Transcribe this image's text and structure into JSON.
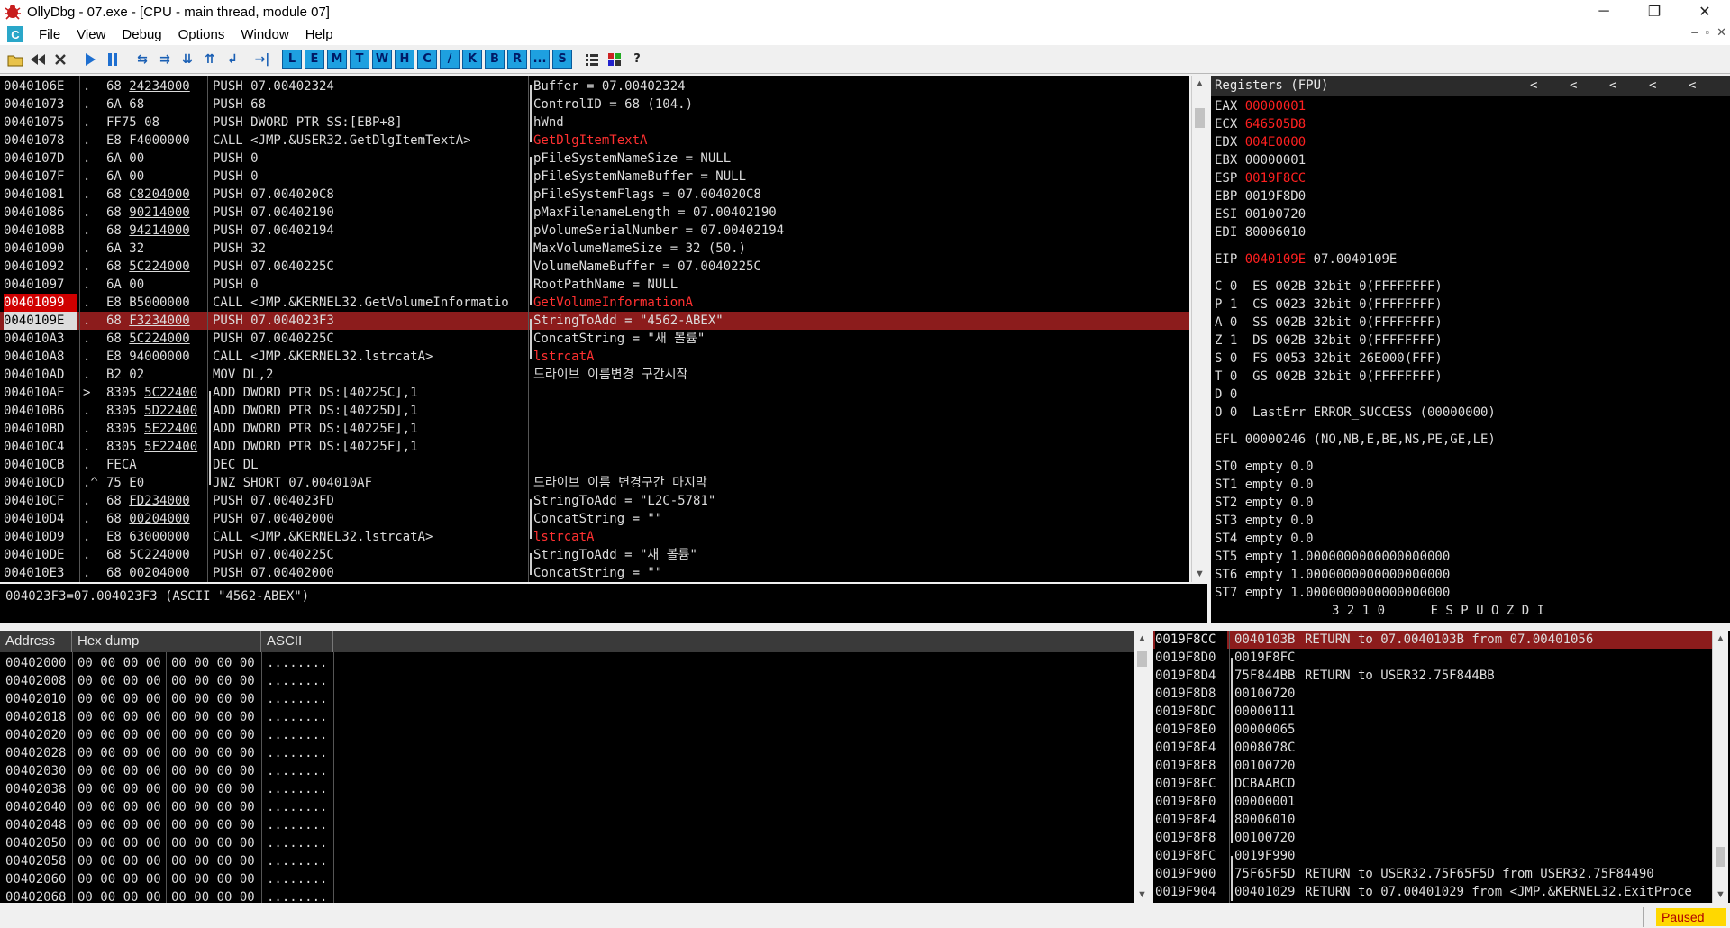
{
  "window": {
    "title": "OllyDbg - 07.exe - [CPU - main thread, module 07]",
    "minimize": "─",
    "maximize": "❐",
    "close": "✕"
  },
  "menu": {
    "cpu_badge": "C",
    "items": [
      "File",
      "View",
      "Debug",
      "Options",
      "Window",
      "Help"
    ],
    "mdi": [
      "–",
      "▫",
      "✕"
    ]
  },
  "toolbar": {
    "letters": [
      "L",
      "E",
      "M",
      "T",
      "W",
      "H",
      "C",
      "/",
      "K",
      "B",
      "R",
      "...",
      "S"
    ]
  },
  "disasm": {
    "rows": [
      {
        "addr": "0040106E",
        "mk": ".",
        "hex": "68 ",
        "hexu": "24234000",
        "ins": "PUSH 07.00402324",
        "cmt": "Buffer = 07.00402324",
        "red": false
      },
      {
        "addr": "00401073",
        "mk": ".",
        "hex": "6A 68",
        "hexu": "",
        "ins": "PUSH 68",
        "cmt": "ControlID = 68 (104.)",
        "red": false
      },
      {
        "addr": "00401075",
        "mk": ".",
        "hex": "FF75 08",
        "hexu": "",
        "ins": "PUSH DWORD PTR SS:[EBP+8]",
        "cmt": "hWnd",
        "red": false
      },
      {
        "addr": "00401078",
        "mk": ".",
        "hex": "E8 F4000000",
        "hexu": "",
        "ins": "CALL <JMP.&USER32.GetDlgItemTextA>",
        "cmt": "GetDlgItemTextA",
        "red": true
      },
      {
        "addr": "0040107D",
        "mk": ".",
        "hex": "6A 00",
        "hexu": "",
        "ins": "PUSH 0",
        "cmt": "pFileSystemNameSize = NULL",
        "red": false
      },
      {
        "addr": "0040107F",
        "mk": ".",
        "hex": "6A 00",
        "hexu": "",
        "ins": "PUSH 0",
        "cmt": "pFileSystemNameBuffer = NULL",
        "red": false
      },
      {
        "addr": "00401081",
        "mk": ".",
        "hex": "68 ",
        "hexu": "C8204000",
        "ins": "PUSH 07.004020C8",
        "cmt": "pFileSystemFlags = 07.004020C8",
        "red": false
      },
      {
        "addr": "00401086",
        "mk": ".",
        "hex": "68 ",
        "hexu": "90214000",
        "ins": "PUSH 07.00402190",
        "cmt": "pMaxFilenameLength = 07.00402190",
        "red": false
      },
      {
        "addr": "0040108B",
        "mk": ".",
        "hex": "68 ",
        "hexu": "94214000",
        "ins": "PUSH 07.00402194",
        "cmt": "pVolumeSerialNumber = 07.00402194",
        "red": false
      },
      {
        "addr": "00401090",
        "mk": ".",
        "hex": "6A 32",
        "hexu": "",
        "ins": "PUSH 32",
        "cmt": "MaxVolumeNameSize = 32 (50.)",
        "red": false
      },
      {
        "addr": "00401092",
        "mk": ".",
        "hex": "68 ",
        "hexu": "5C224000",
        "ins": "PUSH 07.0040225C",
        "cmt": "VolumeNameBuffer = 07.0040225C",
        "red": false
      },
      {
        "addr": "00401097",
        "mk": ".",
        "hex": "6A 00",
        "hexu": "",
        "ins": "PUSH 0",
        "cmt": "RootPathName = NULL",
        "red": false
      },
      {
        "addr": "00401099",
        "mk": ".",
        "hex": "E8 B5000000",
        "hexu": "",
        "ins": "CALL <JMP.&KERNEL32.GetVolumeInformatio",
        "cmt": "GetVolumeInformationA",
        "red": true
      },
      {
        "addr": "0040109E",
        "mk": ".",
        "hex": "68 ",
        "hexu": "F3234000",
        "ins": "PUSH 07.004023F3",
        "cmt": "StringToAdd = \"4562-ABEX\"",
        "red": false
      },
      {
        "addr": "004010A3",
        "mk": ".",
        "hex": "68 ",
        "hexu": "5C224000",
        "ins": "PUSH 07.0040225C",
        "cmt": "ConcatString = \"새 볼륨\"",
        "red": false
      },
      {
        "addr": "004010A8",
        "mk": ".",
        "hex": "E8 94000000",
        "hexu": "",
        "ins": "CALL <JMP.&KERNEL32.lstrcatA>",
        "cmt": "lstrcatA",
        "red": true
      },
      {
        "addr": "004010AD",
        "mk": ".",
        "hex": "B2 02",
        "hexu": "",
        "ins": "MOV DL,2",
        "cmt": "드라이브 이름변경 구간시작",
        "red": false
      },
      {
        "addr": "004010AF",
        "mk": ">",
        "hex": "8305 ",
        "hexu": "5C22400",
        "ins": "ADD DWORD PTR DS:[40225C],1",
        "cmt": "",
        "red": false
      },
      {
        "addr": "004010B6",
        "mk": ".",
        "hex": "8305 ",
        "hexu": "5D22400",
        "ins": "ADD DWORD PTR DS:[40225D],1",
        "cmt": "",
        "red": false
      },
      {
        "addr": "004010BD",
        "mk": ".",
        "hex": "8305 ",
        "hexu": "5E22400",
        "ins": "ADD DWORD PTR DS:[40225E],1",
        "cmt": "",
        "red": false
      },
      {
        "addr": "004010C4",
        "mk": ".",
        "hex": "8305 ",
        "hexu": "5F22400",
        "ins": "ADD DWORD PTR DS:[40225F],1",
        "cmt": "",
        "red": false
      },
      {
        "addr": "004010CB",
        "mk": ".",
        "hex": "FECA",
        "hexu": "",
        "ins": "DEC DL",
        "cmt": "",
        "red": false
      },
      {
        "addr": "004010CD",
        "mk": ".^",
        "hex": "75 E0",
        "hexu": "",
        "ins": "JNZ SHORT 07.004010AF",
        "cmt": "드라이브 이름 변경구간 마지막",
        "red": false
      },
      {
        "addr": "004010CF",
        "mk": ".",
        "hex": "68 ",
        "hexu": "FD234000",
        "ins": "PUSH 07.004023FD",
        "cmt": "StringToAdd = \"L2C-5781\"",
        "red": false
      },
      {
        "addr": "004010D4",
        "mk": ".",
        "hex": "68 ",
        "hexu": "00204000",
        "ins": "PUSH 07.00402000",
        "cmt": "ConcatString = \"\"",
        "red": false
      },
      {
        "addr": "004010D9",
        "mk": ".",
        "hex": "E8 63000000",
        "hexu": "",
        "ins": "CALL <JMP.&KERNEL32.lstrcatA>",
        "cmt": "lstrcatA",
        "red": true
      },
      {
        "addr": "004010DE",
        "mk": ".",
        "hex": "68 ",
        "hexu": "5C224000",
        "ins": "PUSH 07.0040225C",
        "cmt": "StringToAdd = \"새 볼륨\"",
        "red": false
      },
      {
        "addr": "004010E3",
        "mk": ".",
        "hex": "68 ",
        "hexu": "00204000",
        "ins": "PUSH 07.00402000",
        "cmt": "ConcatString = \"\"",
        "red": false
      }
    ],
    "info": "004023F3=07.004023F3 (ASCII \"4562-ABEX\")"
  },
  "registers": {
    "title": "Registers (FPU)",
    "arrows": [
      "<",
      "<",
      "<",
      "<",
      "<"
    ],
    "gp": [
      {
        "name": "EAX",
        "val": "00000001",
        "rest": "",
        "red": true
      },
      {
        "name": "ECX",
        "val": "646505D8",
        "rest": "",
        "red": true
      },
      {
        "name": "EDX",
        "val": "004E0000",
        "rest": "",
        "red": true
      },
      {
        "name": "EBX",
        "val": "00000001",
        "rest": "",
        "red": false
      },
      {
        "name": "ESP",
        "val": "0019F8CC",
        "rest": "",
        "red": true
      },
      {
        "name": "EBP",
        "val": "0019F8D0",
        "rest": "",
        "red": false
      },
      {
        "name": "ESI",
        "val": "00100720",
        "rest": "",
        "red": false
      },
      {
        "name": "EDI",
        "val": "80006010",
        "rest": "",
        "red": false
      }
    ],
    "eip": {
      "name": "EIP",
      "val": "0040109E",
      "rest": "07.0040109E"
    },
    "flags": [
      "C 0  ES 002B 32bit 0(FFFFFFFF)",
      "P 1  CS 0023 32bit 0(FFFFFFFF)",
      "A 0  SS 002B 32bit 0(FFFFFFFF)",
      "Z 1  DS 002B 32bit 0(FFFFFFFF)",
      "S 0  FS 0053 32bit 26E000(FFF)",
      "T 0  GS 002B 32bit 0(FFFFFFFF)",
      "D 0",
      "O 0  LastErr ERROR_SUCCESS (00000000)"
    ],
    "efl": "EFL 00000246 (NO,NB,E,BE,NS,PE,GE,LE)",
    "fpu": [
      "ST0 empty 0.0",
      "ST1 empty 0.0",
      "ST2 empty 0.0",
      "ST3 empty 0.0",
      "ST4 empty 0.0",
      "ST5 empty 1.0000000000000000000",
      "ST6 empty 1.0000000000000000000",
      "ST7 empty 1.0000000000000000000"
    ],
    "fpu_bits": "3 2 1 0      E S P U O Z D I"
  },
  "dump": {
    "headers": {
      "address": "Address",
      "hex": "Hex dump",
      "ascii": "ASCII"
    },
    "rows": [
      [
        "00402000",
        "00 00 00 00",
        "00 00 00 00",
        "........"
      ],
      [
        "00402008",
        "00 00 00 00",
        "00 00 00 00",
        "........"
      ],
      [
        "00402010",
        "00 00 00 00",
        "00 00 00 00",
        "........"
      ],
      [
        "00402018",
        "00 00 00 00",
        "00 00 00 00",
        "........"
      ],
      [
        "00402020",
        "00 00 00 00",
        "00 00 00 00",
        "........"
      ],
      [
        "00402028",
        "00 00 00 00",
        "00 00 00 00",
        "........"
      ],
      [
        "00402030",
        "00 00 00 00",
        "00 00 00 00",
        "........"
      ],
      [
        "00402038",
        "00 00 00 00",
        "00 00 00 00",
        "........"
      ],
      [
        "00402040",
        "00 00 00 00",
        "00 00 00 00",
        "........"
      ],
      [
        "00402048",
        "00 00 00 00",
        "00 00 00 00",
        "........"
      ],
      [
        "00402050",
        "00 00 00 00",
        "00 00 00 00",
        "........"
      ],
      [
        "00402058",
        "00 00 00 00",
        "00 00 00 00",
        "........"
      ],
      [
        "00402060",
        "00 00 00 00",
        "00 00 00 00",
        "........"
      ],
      [
        "00402068",
        "00 00 00 00",
        "00 00 00 00",
        "........"
      ]
    ]
  },
  "stack": {
    "rows": [
      [
        "0019F8CC",
        "0040103B",
        "RETURN to 07.0040103B from 07.00401056"
      ],
      [
        "0019F8D0",
        "0019F8FC",
        ""
      ],
      [
        "0019F8D4",
        "75F844BB",
        "RETURN to USER32.75F844BB"
      ],
      [
        "0019F8D8",
        "00100720",
        ""
      ],
      [
        "0019F8DC",
        "00000111",
        ""
      ],
      [
        "0019F8E0",
        "00000065",
        ""
      ],
      [
        "0019F8E4",
        "0008078C",
        ""
      ],
      [
        "0019F8E8",
        "00100720",
        ""
      ],
      [
        "0019F8EC",
        "DCBAABCD",
        ""
      ],
      [
        "0019F8F0",
        "00000001",
        ""
      ],
      [
        "0019F8F4",
        "80006010",
        ""
      ],
      [
        "0019F8F8",
        "00100720",
        ""
      ],
      [
        "0019F8FC",
        "0019F990",
        ""
      ],
      [
        "0019F900",
        "75F65F5D",
        "RETURN to USER32.75F65F5D from USER32.75F84490"
      ],
      [
        "0019F904",
        "00401029",
        "RETURN to 07.00401029 from <JMP.&KERNEL32.ExitProce"
      ]
    ]
  },
  "status": {
    "state": "Paused"
  }
}
